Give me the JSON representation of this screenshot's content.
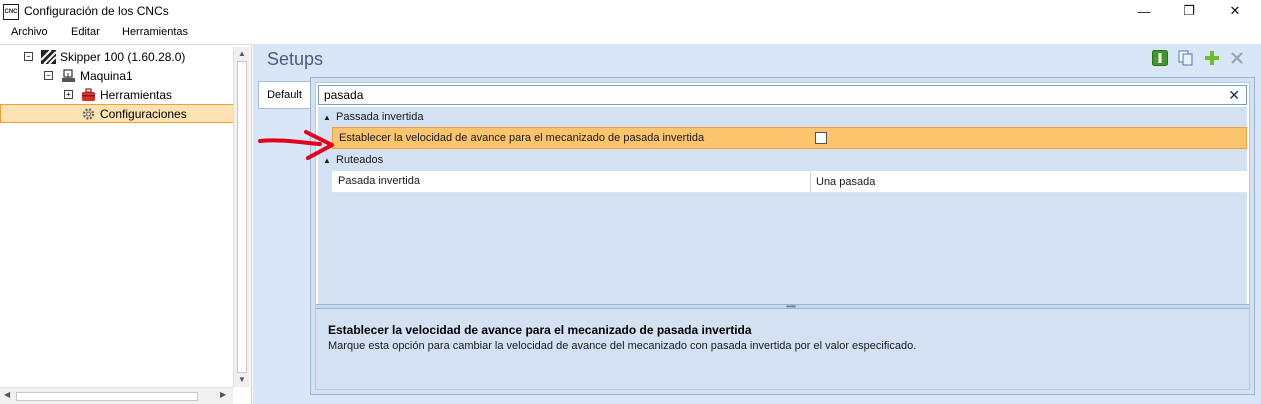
{
  "window": {
    "app_icon_text": "CNC",
    "title": "Configuración de los CNCs",
    "minimize": "—",
    "maximize": "❐",
    "close": "✕"
  },
  "menu": {
    "items": [
      "Archivo",
      "Editar",
      "Herramientas"
    ]
  },
  "tree": {
    "nodes": [
      {
        "label": "Skipper 100 (1.60.28.0)",
        "icon": "machine-stripes-icon",
        "expander": "−"
      },
      {
        "label": "Maquina1",
        "icon": "machine-icon",
        "expander": "−"
      },
      {
        "label": "Herramientas",
        "icon": "toolbox-icon",
        "expander": "+"
      },
      {
        "label": "Configuraciones",
        "icon": "gear-icon",
        "selected": true
      }
    ]
  },
  "setups": {
    "title": "Setups",
    "toolbar": [
      "info-icon",
      "copy-icon",
      "add-icon",
      "delete-icon"
    ],
    "tab": "Default",
    "search_value": "pasada",
    "search_clear": "✕",
    "categories": [
      {
        "name": "Passada invertida",
        "properties": [
          {
            "name": "Establecer la velocidad de avance para el mecanizado de pasada invertida",
            "type": "checkbox",
            "checked": false,
            "selected": true
          }
        ]
      },
      {
        "name": "Ruteados",
        "properties": [
          {
            "name": "Pasada invertida",
            "type": "text",
            "value": "Una pasada"
          }
        ]
      }
    ],
    "help": {
      "title": "Establecer la velocidad de avance para el mecanizado de pasada invertida",
      "description": "Marque esta opción para cambiar la velocidad de avance del mecanizado con pasada invertida por el valor especificado."
    }
  },
  "colors": {
    "accent_selected": "#fbc46d",
    "panel_bg": "#d9e6f7",
    "arrow": "#e3001b"
  }
}
